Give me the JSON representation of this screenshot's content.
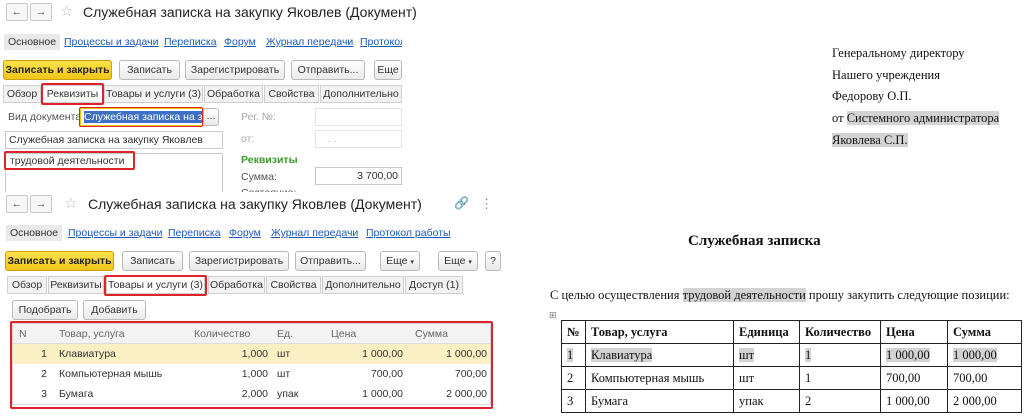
{
  "window1": {
    "back": "←",
    "forward": "→",
    "star": "☆",
    "title": "Служебная записка на закупку Яковлев (Документ)",
    "nav": [
      "Основное",
      "Процессы и задачи",
      "Переписка",
      "Форум",
      "Журнал передачи",
      "Протокол"
    ],
    "toolbar": {
      "save_close": "Записать и закрыть",
      "save": "Записать",
      "register": "Зарегистрировать",
      "send": "Отправить...",
      "more": "Еще"
    },
    "tabs": [
      "Обзор",
      "Реквизиты",
      "Товары и услуги (3)",
      "Обработка",
      "Свойства",
      "Дополнительно"
    ],
    "doc_type_label": "Вид документа:",
    "doc_type_value": "Служебная записка на закуп",
    "doc_type_btn": "...",
    "subject_value": "Служебная записка на закупку Яковлев",
    "text_value": "трудовой деятельности",
    "reg_label": "Рег. №:",
    "from_label": "от:",
    "date_placeholder": ". .",
    "section_title": "Реквизиты",
    "sum_label": "Сумма:",
    "sum_value": "3 700,00",
    "status_label": "Состояние:"
  },
  "window2": {
    "back": "←",
    "forward": "→",
    "star": "☆",
    "link_icon": "🔗",
    "menu_icon": "⋮",
    "title": "Служебная записка на закупку Яковлев (Документ)",
    "nav": [
      "Основное",
      "Процессы и задачи",
      "Переписка",
      "Форум",
      "Журнал передачи",
      "Протокол работы"
    ],
    "toolbar": {
      "save_close": "Записать и закрыть",
      "save": "Записать",
      "register": "Зарегистрировать",
      "send": "Отправить...",
      "more1": "Еще",
      "more2": "Еще",
      "help": "?"
    },
    "tabs": [
      "Обзор",
      "Реквизиты",
      "Товары и услуги (3)",
      "Обработка",
      "Свойства",
      "Дополнительно",
      "Доступ (1)"
    ],
    "pick_btn": "Подобрать",
    "add_btn": "Добавить",
    "grid": {
      "headers": [
        "N",
        "Товар, услуга",
        "Количество",
        "Ед.",
        "Цена",
        "Сумма"
      ],
      "rows": [
        [
          "1",
          "Клавиатура",
          "1,000",
          "шт",
          "1 000,00",
          "1 000,00"
        ],
        [
          "2",
          "Компьютерная мышь",
          "1,000",
          "шт",
          "700,00",
          "700,00"
        ],
        [
          "3",
          "Бумага",
          "2,000",
          "упак",
          "1 000,00",
          "2 000,00"
        ]
      ]
    }
  },
  "document": {
    "addressee": [
      "Генеральному директору",
      "Нашего учреждения",
      "Федорову О.П."
    ],
    "from_prefix": "от ",
    "from_highlight": "Системного администратора",
    "from_name": "Яковлева С.П.",
    "title": "Служебная записка",
    "body_prefix": "С целью осуществления ",
    "body_highlight": "трудовой деятельности",
    "body_suffix": " прошу закупить следующие позиции:",
    "table_anchor": "⊞",
    "table": {
      "headers": [
        "№",
        "Товар, услуга",
        "Единица",
        "Количество",
        "Цена",
        "Сумма"
      ],
      "rows": [
        [
          "1",
          "Клавиатура",
          "шт",
          "1",
          "1 000,00",
          "1 000,00"
        ],
        [
          "2",
          "Компьютерная мышь",
          "шт",
          "1",
          "700,00",
          "700,00"
        ],
        [
          "3",
          "Бумага",
          "упак",
          "2",
          "1 000,00",
          "2 000,00"
        ]
      ]
    }
  },
  "colors": {
    "primary_button": "#f3c516",
    "link": "#1d58b9",
    "highlight_red": "#e0232a",
    "section_green": "#3a9a28",
    "selected_row": "#faf0c4",
    "doc_highlight": "#d3d3d3"
  }
}
